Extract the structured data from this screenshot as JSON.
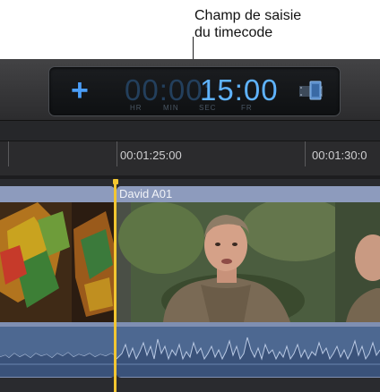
{
  "callout": {
    "line1": "Champ de saisie",
    "line2": "du timecode"
  },
  "timecode": {
    "plus": "+",
    "dim_digits": "00:00:",
    "bright_digits": "15:00",
    "units": [
      "HR",
      "MIN",
      "SEC",
      "FR"
    ],
    "accent_color": "#5fb3ff",
    "dim_color": "#233f5c"
  },
  "ruler": {
    "labels": [
      "00:01:25:00",
      "00:01:30:0"
    ]
  },
  "clips": {
    "right_title": "David A01"
  },
  "colors": {
    "playhead": "#f2c631",
    "clip": "#7f8fb2",
    "audio": "#4d6891"
  }
}
